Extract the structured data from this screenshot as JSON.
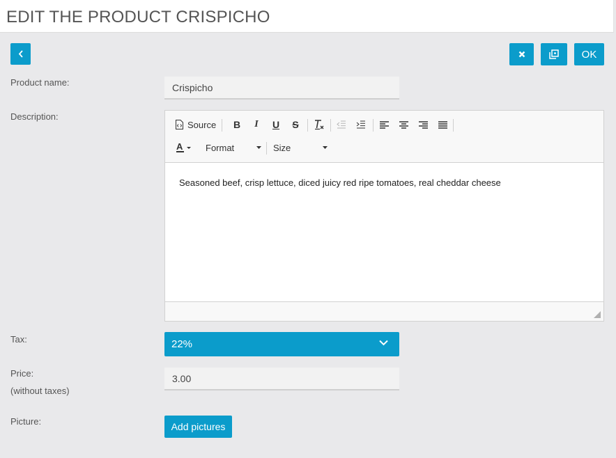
{
  "header": {
    "title": "EDIT THE PRODUCT CRISPICHO"
  },
  "actions": {
    "back_icon": "chevron-left-icon",
    "close_icon": "close-x-icon",
    "duplicate_icon": "duplicate-icon",
    "ok_label": "OK"
  },
  "form": {
    "product_name": {
      "label": "Product name:",
      "value": "Crispicho"
    },
    "description": {
      "label": "Description:",
      "toolbar": {
        "source_label": "Source",
        "format_label": "Format",
        "size_label": "Size"
      },
      "content": "Seasoned beef, crisp lettuce, diced juicy red ripe tomatoes, real cheddar cheese"
    },
    "tax": {
      "label": "Tax:",
      "selected": "22%"
    },
    "price": {
      "label": "Price:",
      "sublabel": "(without taxes)",
      "value": "3.00"
    },
    "picture": {
      "label": "Picture:",
      "button_label": "Add pictures"
    }
  },
  "colors": {
    "accent": "#0b9ccb",
    "background": "#e9e9eb"
  }
}
